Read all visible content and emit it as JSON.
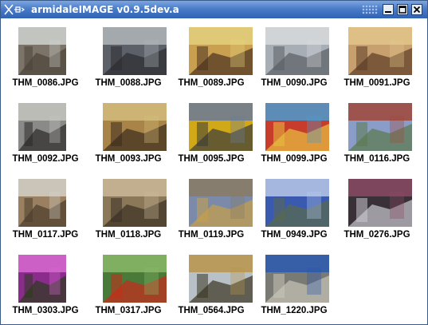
{
  "window": {
    "title": "armidaleIMAGE v0.9.5dev.a",
    "accent": "#3a6cc0"
  },
  "thumbnails": [
    {
      "filename": "THM_0086.JPG",
      "colors": [
        "#7c7468",
        "#cfd2cf",
        "#4c4438"
      ]
    },
    {
      "filename": "THM_0088.JPG",
      "colors": [
        "#5c6068",
        "#b0b6ba",
        "#2c2c30"
      ]
    },
    {
      "filename": "THM_0089.JPG",
      "colors": [
        "#c8a050",
        "#e4d07c",
        "#4a3220"
      ]
    },
    {
      "filename": "THM_0090.JPG",
      "colors": [
        "#a8aeb6",
        "#d8dadc",
        "#5a5e64"
      ]
    },
    {
      "filename": "THM_0091.JPG",
      "colors": [
        "#c8a070",
        "#e2c68a",
        "#5a3a24"
      ]
    },
    {
      "filename": "THM_0092.JPG",
      "colors": [
        "#8a8a88",
        "#c4c4c0",
        "#2c2a28"
      ]
    },
    {
      "filename": "THM_0093.JPG",
      "colors": [
        "#a88448",
        "#d4bc7c",
        "#3c2c1c"
      ]
    },
    {
      "filename": "THM_0095.JPG",
      "colors": [
        "#d0a818",
        "#6a7a9a",
        "#3a3a3a"
      ]
    },
    {
      "filename": "THM_0099.JPG",
      "colors": [
        "#c83c2c",
        "#4a9ad0",
        "#e8c040"
      ]
    },
    {
      "filename": "THM_0116.JPG",
      "colors": [
        "#8a9cc8",
        "#a0483a",
        "#5a7a4a"
      ]
    },
    {
      "filename": "THM_0117.JPG",
      "colors": [
        "#9a8060",
        "#d4d0c8",
        "#4a3c2c"
      ]
    },
    {
      "filename": "THM_0118.JPG",
      "colors": [
        "#8a7858",
        "#cab89a",
        "#3a3024"
      ]
    },
    {
      "filename": "THM_0119.JPG",
      "colors": [
        "#7a8aa8",
        "#8a7a64",
        "#c8a048"
      ]
    },
    {
      "filename": "THM_0949.JPG",
      "colors": [
        "#3a5ab0",
        "#b8c8e8",
        "#5a6a4a"
      ]
    },
    {
      "filename": "THM_0276.JPG",
      "colors": [
        "#3a3038",
        "#8a4a64",
        "#c8c8d0"
      ]
    },
    {
      "filename": "THM_0303.JPG",
      "colors": [
        "#8a2c8c",
        "#d86ad0",
        "#2c3a1c"
      ]
    },
    {
      "filename": "THM_0317.JPG",
      "colors": [
        "#4a7a3a",
        "#8ab86a",
        "#c82a1a"
      ]
    },
    {
      "filename": "THM_0564.JPG",
      "colors": [
        "#b8c0c8",
        "#b8944a",
        "#3a3420"
      ]
    },
    {
      "filename": "THM_1220.JPG",
      "colors": [
        "#7a7a74",
        "#2c5ab0",
        "#c8c4b8"
      ]
    }
  ]
}
